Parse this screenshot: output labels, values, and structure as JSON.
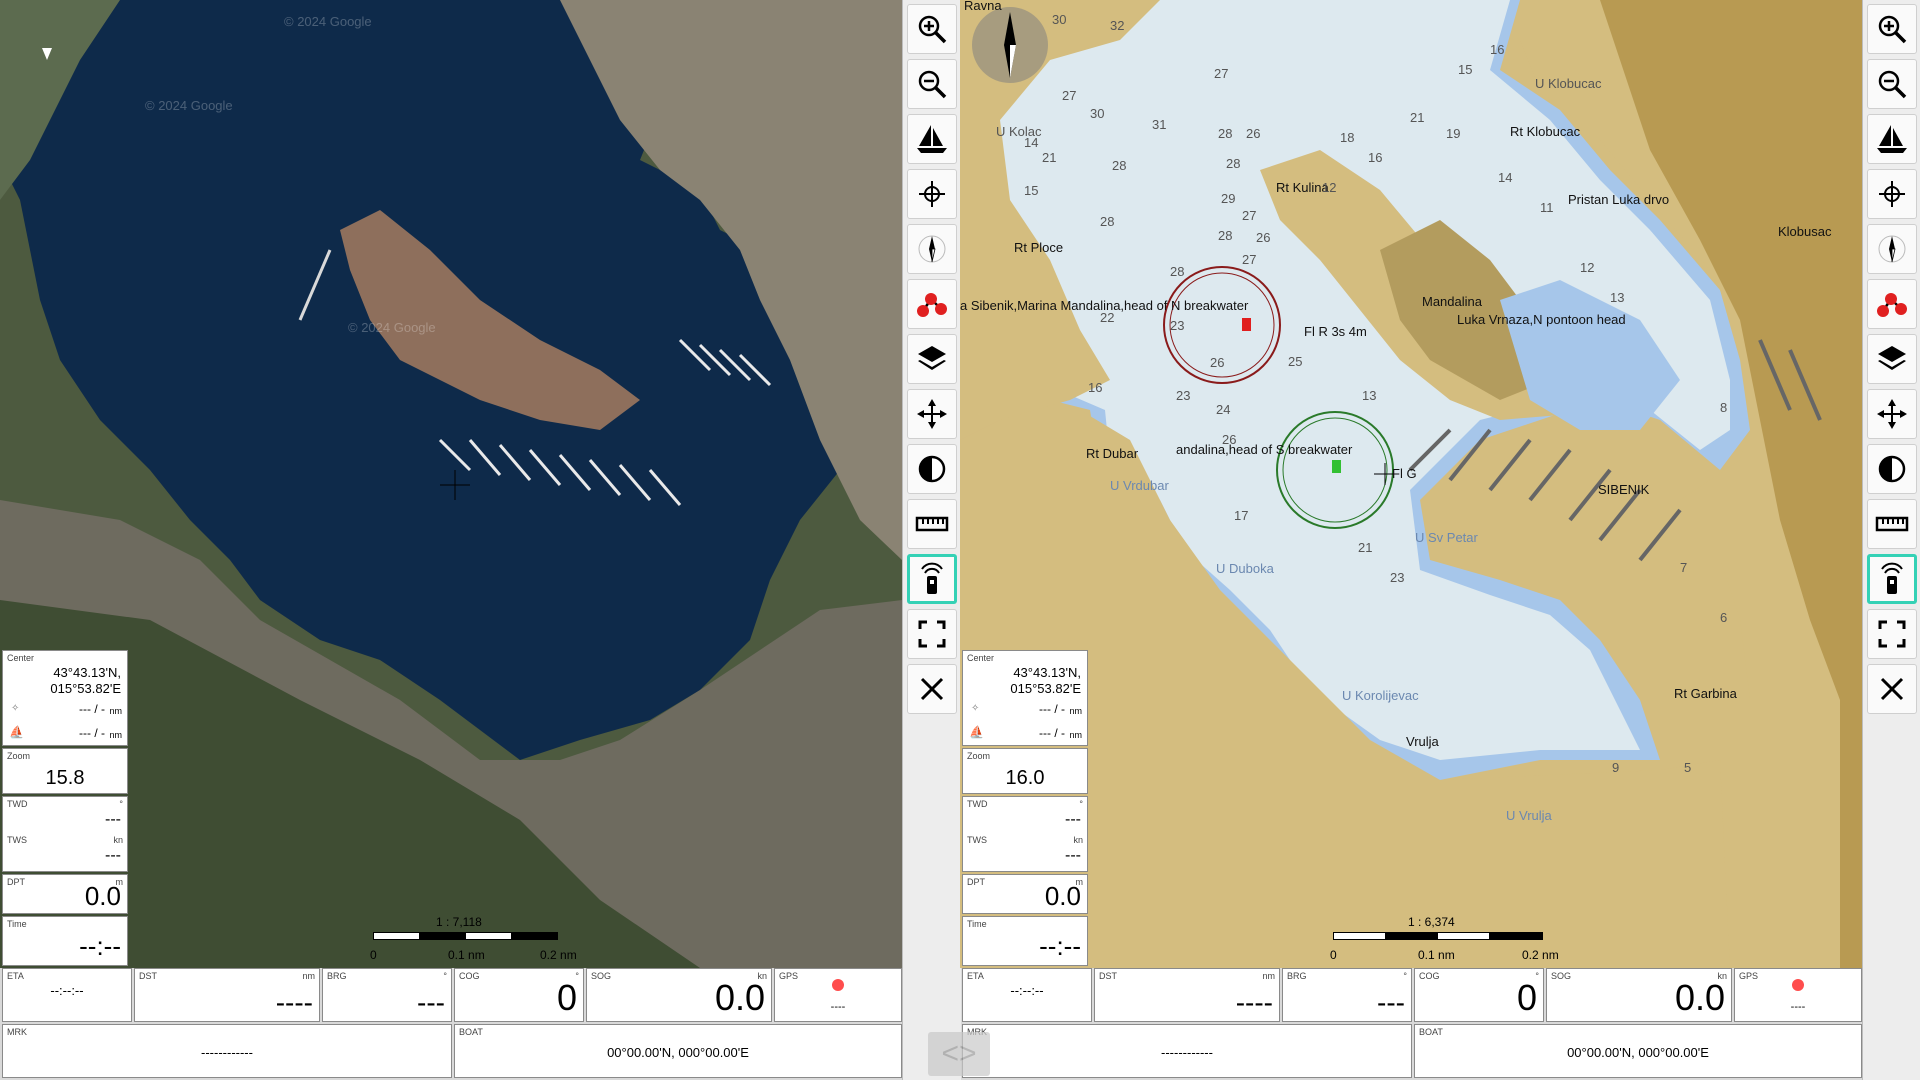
{
  "left": {
    "center": {
      "label": "Center",
      "lat": "43°43.13'N,",
      "lon": "015°53.82'E"
    },
    "dist1": {
      "value": "--- / -",
      "unit": "nm"
    },
    "dist2": {
      "value": "--- / -",
      "unit": "nm"
    },
    "zoom": {
      "label": "Zoom",
      "value": "15.8"
    },
    "twd": {
      "label": "TWD",
      "unit": "°",
      "value": "---"
    },
    "tws": {
      "label": "TWS",
      "unit": "kn",
      "value": "---"
    },
    "dpt": {
      "label": "DPT",
      "unit": "m",
      "value": "0.0"
    },
    "time": {
      "label": "Time",
      "value": "--:--"
    },
    "scale": {
      "ratio": "1 : 7,118",
      "t0": "0",
      "t1": "0.1 nm",
      "t2": "0.2 nm"
    },
    "watermarks": [
      "© 2024 Google",
      "© 2024 Google",
      "© 2024 Google"
    ],
    "bottom": {
      "eta": {
        "label": "ETA",
        "value": "--:--:--"
      },
      "dst": {
        "label": "DST",
        "unit": "nm",
        "value": "----"
      },
      "brg": {
        "label": "BRG",
        "unit": "°",
        "value": "---"
      },
      "cog": {
        "label": "COG",
        "unit": "°",
        "value": "0"
      },
      "sog": {
        "label": "SOG",
        "unit": "kn",
        "value": "0.0"
      },
      "gps": {
        "label": "GPS",
        "value": "----"
      },
      "mrk": {
        "label": "MRK",
        "value": "------------"
      },
      "boat": {
        "label": "BOAT",
        "value": "00°00.00'N, 000°00.00'E"
      }
    }
  },
  "right": {
    "center": {
      "label": "Center",
      "lat": "43°43.13'N,",
      "lon": "015°53.82'E"
    },
    "dist1": {
      "value": "--- / -",
      "unit": "nm"
    },
    "dist2": {
      "value": "--- / -",
      "unit": "nm"
    },
    "zoom": {
      "label": "Zoom",
      "value": "16.0"
    },
    "twd": {
      "label": "TWD",
      "unit": "°",
      "value": "---"
    },
    "tws": {
      "label": "TWS",
      "unit": "kn",
      "value": "---"
    },
    "dpt": {
      "label": "DPT",
      "unit": "m",
      "value": "0.0"
    },
    "time": {
      "label": "Time",
      "value": "--:--"
    },
    "scale": {
      "ratio": "1 : 6,374",
      "t0": "0",
      "t1": "0.1 nm",
      "t2": "0.2 nm"
    },
    "chart_labels": {
      "ravna": "Ravna",
      "klobucac1": "U Klobucac",
      "rtklobucac": "Rt Klobucac",
      "pristan": "Pristan Luka drvo",
      "klobusac": "Klobusac",
      "rtkulina": "Rt Kulina",
      "rtploce": "Rt Ploce",
      "mandalina": "Mandalina",
      "nbreak": "a Sibenik,Marina Mandalina,head of N breakwater",
      "flr": "Fl R 3s 4m",
      "vrnaza": "Luka Vrnaza,N pontoon head",
      "sbreak": "andalina,head of S breakwater",
      "flg": "Fl G",
      "rtdubar": "Rt Dubar",
      "uvrdubar": "U Vrdubar",
      "sibenik": "SIBENIK",
      "usvpetar": "U Sv Petar",
      "uduboka": "U Duboka",
      "ukorolijevac": "U Korolijevac",
      "vrulja": "Vrulja",
      "rtgarbina": "Rt Garbina",
      "uvrulja": "U Vrulja",
      "ukolac": "U Kolac"
    },
    "depths": [
      "30",
      "32",
      "27",
      "27",
      "30",
      "31",
      "28",
      "26",
      "28",
      "28",
      "28",
      "29",
      "27",
      "28",
      "26",
      "27",
      "28",
      "23",
      "22",
      "26",
      "16",
      "15",
      "14",
      "21",
      "23",
      "24",
      "25",
      "26",
      "17",
      "21",
      "23",
      "13",
      "12",
      "18",
      "16",
      "19",
      "21",
      "15",
      "16",
      "14",
      "11",
      "12",
      "13",
      "8",
      "7",
      "6",
      "5",
      "9"
    ],
    "bottom": {
      "eta": {
        "label": "ETA",
        "value": "--:--:--"
      },
      "dst": {
        "label": "DST",
        "unit": "nm",
        "value": "----"
      },
      "brg": {
        "label": "BRG",
        "unit": "°",
        "value": "---"
      },
      "cog": {
        "label": "COG",
        "unit": "°",
        "value": "0"
      },
      "sog": {
        "label": "SOG",
        "unit": "kn",
        "value": "0.0"
      },
      "gps": {
        "label": "GPS",
        "value": "----"
      },
      "mrk": {
        "label": "MRK",
        "value": "------------"
      },
      "boat": {
        "label": "BOAT",
        "value": "00°00.00'N, 000°00.00'E"
      }
    }
  },
  "toolbar_icons": [
    "zoom-in-icon",
    "zoom-out-icon",
    "boat-icon",
    "crosshair-icon",
    "compass-icon",
    "route-icon",
    "layers-icon",
    "center-icon",
    "contrast-icon",
    "ruler-icon",
    "remote-icon",
    "fullscreen-icon",
    "close-icon"
  ],
  "colors": {
    "gps_dot": "#ff4d4d",
    "active_border": "#34d1b5",
    "land": "#d4bd7f",
    "deep": "#dde9ef",
    "shallow": "#a6c6ea"
  },
  "split_arrows": "<>"
}
